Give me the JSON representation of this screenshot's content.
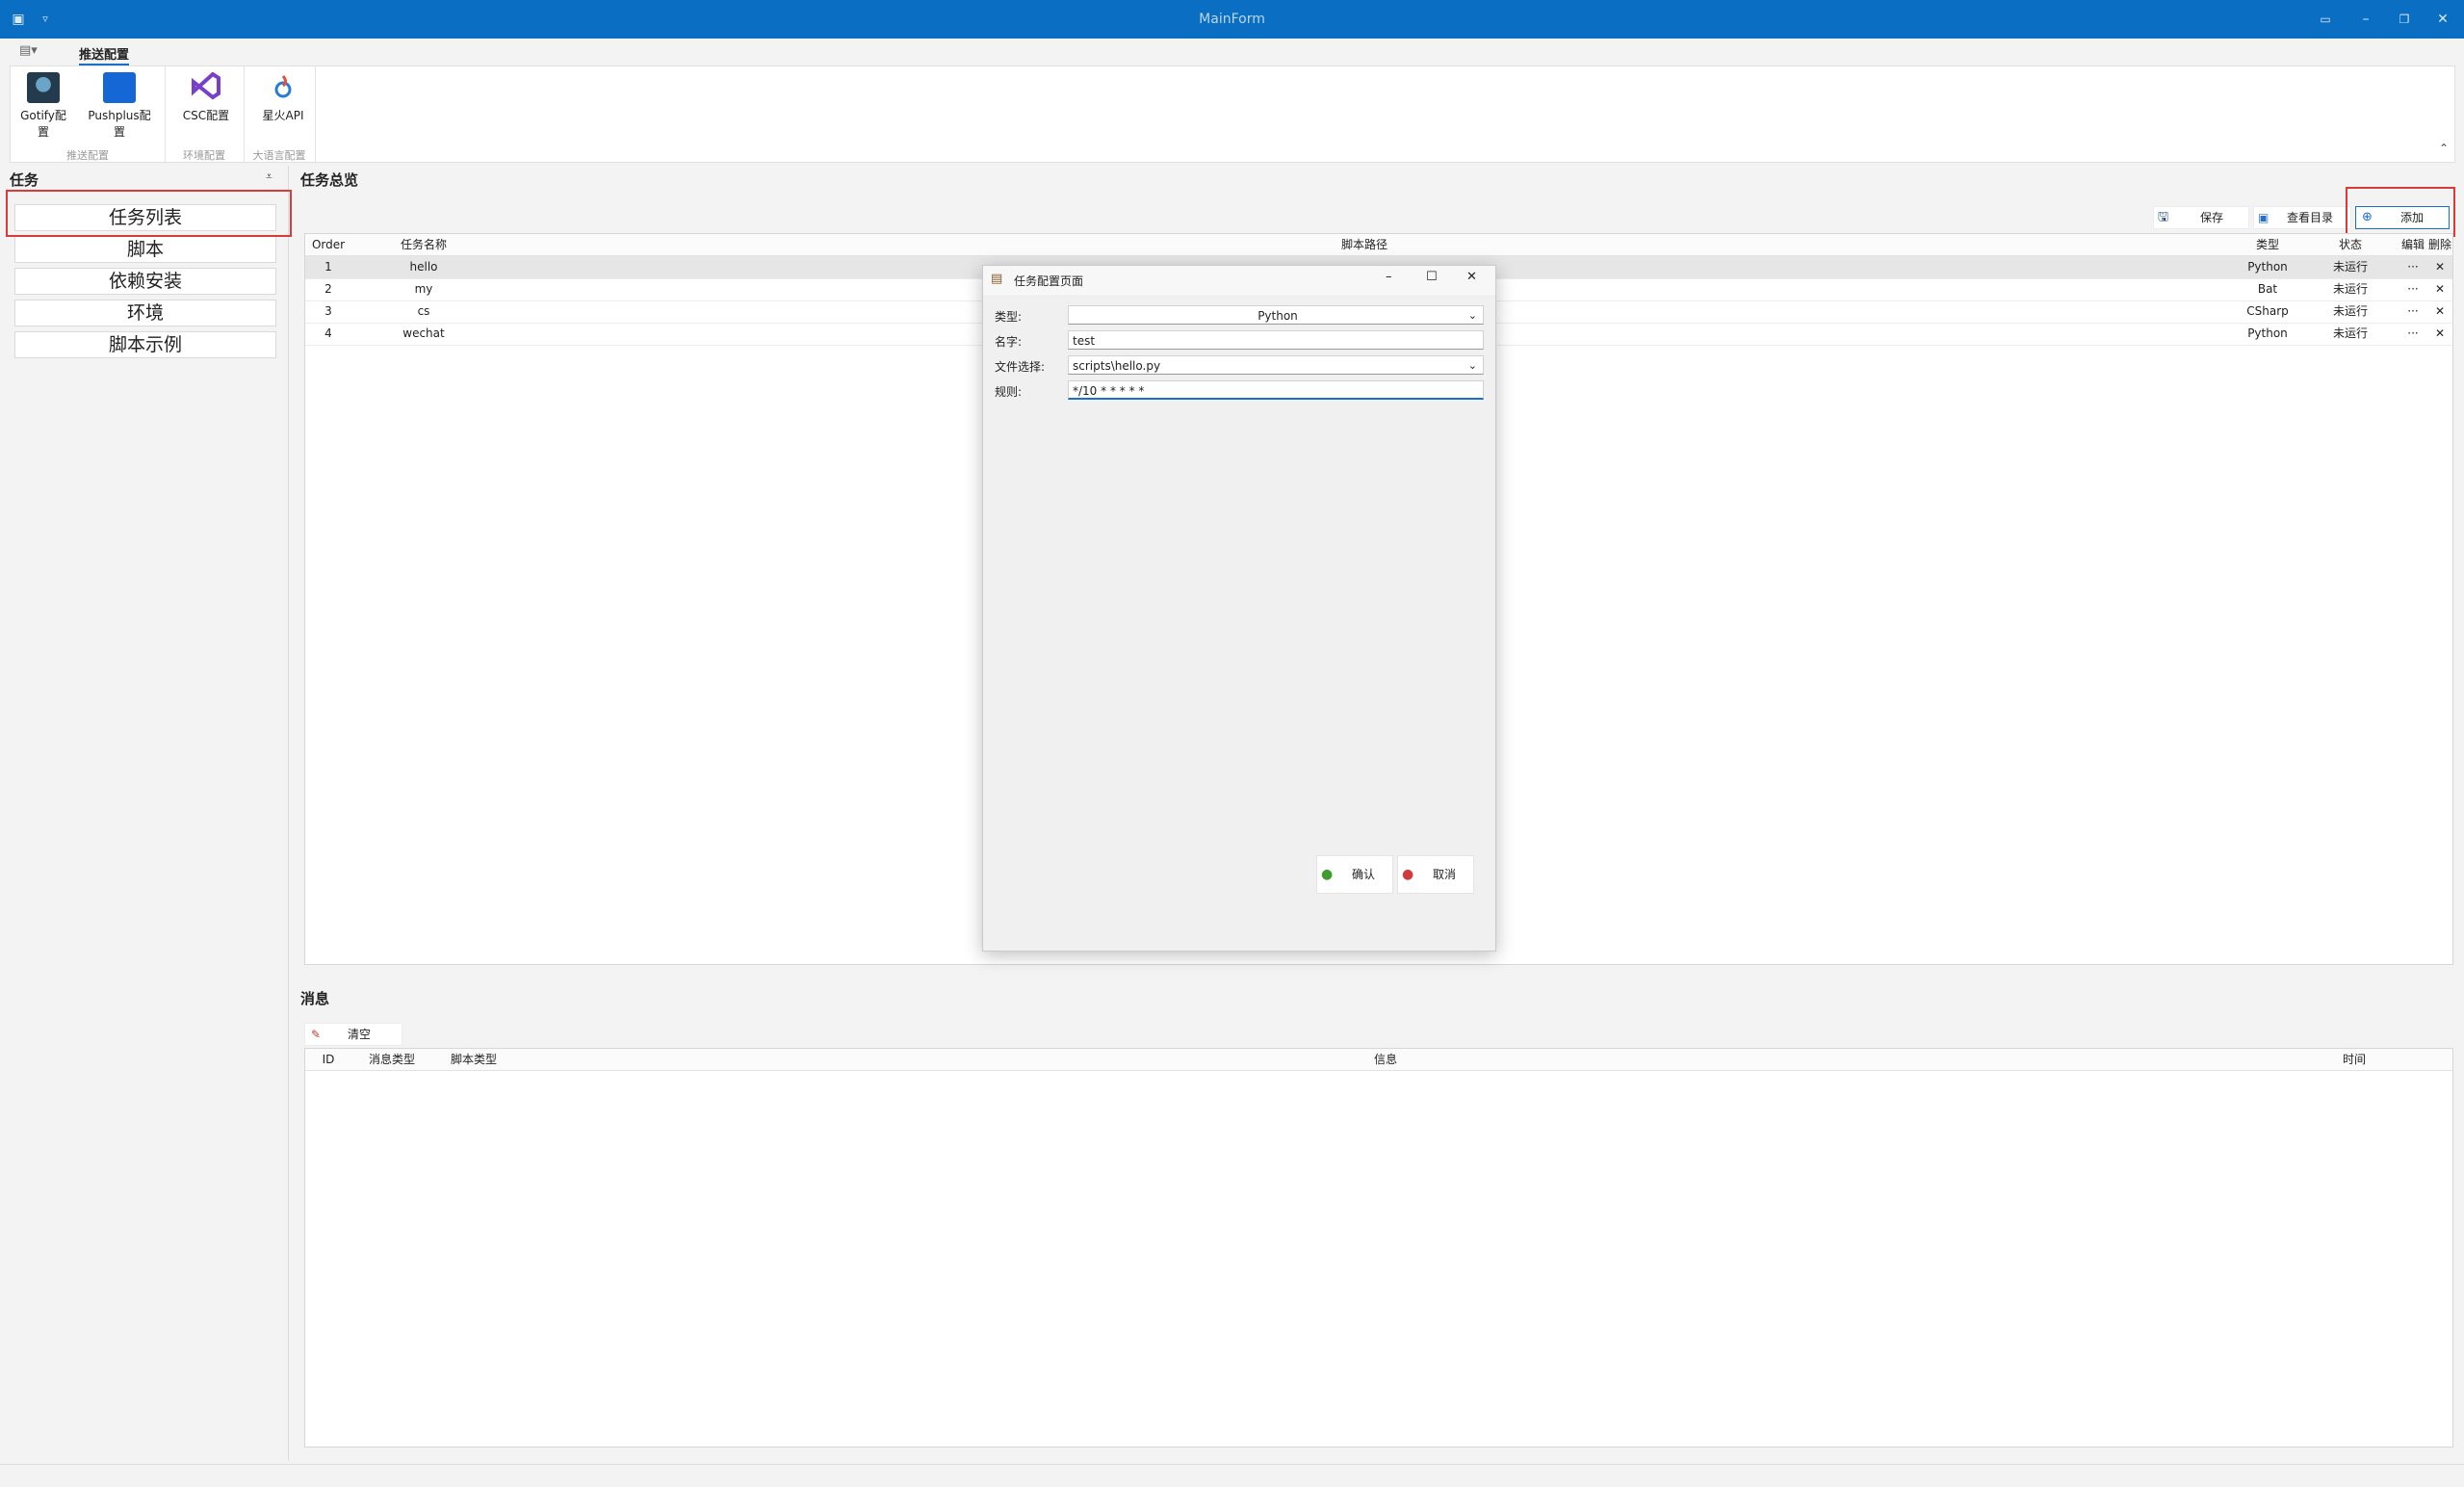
{
  "window": {
    "title": "MainForm"
  },
  "ribbon": {
    "tab_active": "推送配置",
    "buttons": [
      {
        "label": "Gotify配置"
      },
      {
        "label": "Pushplus配置"
      },
      {
        "label": "CSC配置"
      },
      {
        "label": "星火API"
      }
    ],
    "groups": [
      "推送配置",
      "环境配置",
      "大语言配置"
    ]
  },
  "left_panel": {
    "title": "任务",
    "items": [
      "任务列表",
      "脚本",
      "依赖安装",
      "环境",
      "脚本示例"
    ]
  },
  "main": {
    "title": "任务总览",
    "toolbar": {
      "save": "保存",
      "view_dir": "查看目录",
      "add": "添加"
    },
    "columns": [
      "Order",
      "任务名称",
      "脚本路径",
      "类型",
      "状态",
      "编辑",
      "删除"
    ],
    "rows": [
      {
        "order": "1",
        "name": "hello",
        "type": "Python",
        "status": "未运行",
        "edit": "···",
        "del": "✕"
      },
      {
        "order": "2",
        "name": "my",
        "type": "Bat",
        "status": "未运行",
        "edit": "···",
        "del": "✕"
      },
      {
        "order": "3",
        "name": "cs",
        "type": "CSharp",
        "status": "未运行",
        "edit": "···",
        "del": "✕"
      },
      {
        "order": "4",
        "name": "wechat",
        "type": "Python",
        "status": "未运行",
        "edit": "···",
        "del": "✕"
      }
    ]
  },
  "messages": {
    "title": "消息",
    "clear": "清空",
    "columns": [
      "ID",
      "消息类型",
      "脚本类型",
      "信息",
      "时间"
    ]
  },
  "dialog": {
    "title": "任务配置页面",
    "type_label": "类型:",
    "type_value": "Python",
    "name_label": "名字:",
    "name_value": "test",
    "file_label": "文件选择:",
    "file_value": "scripts\\hello.py",
    "rule_label": "规则:",
    "rule_value": "*/10 * * * * *",
    "confirm": "确认",
    "cancel": "取消"
  },
  "colors": {
    "titlebar": "#0a6fc2",
    "highlight": "#d93a3a",
    "accent": "#1a6fc9"
  }
}
